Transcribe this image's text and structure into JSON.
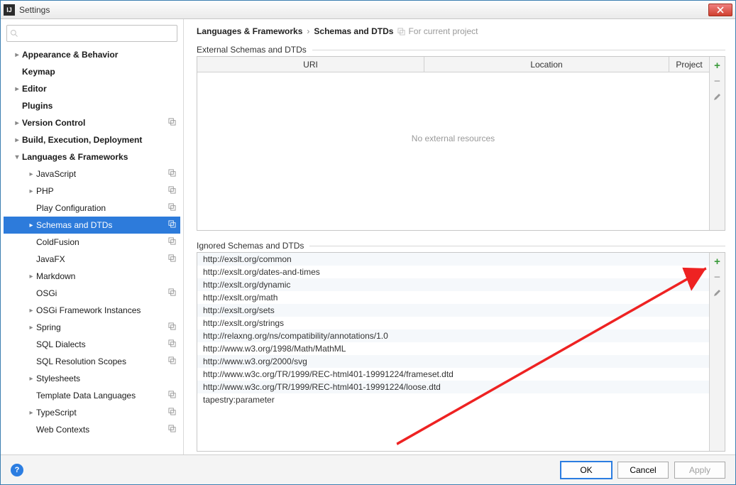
{
  "window": {
    "title": "Settings"
  },
  "search": {
    "placeholder": ""
  },
  "tree": [
    {
      "label": "Appearance & Behavior",
      "level": 0,
      "bold": true,
      "arrow": "right",
      "cp": false
    },
    {
      "label": "Keymap",
      "level": 0,
      "bold": true,
      "arrow": "",
      "cp": false
    },
    {
      "label": "Editor",
      "level": 0,
      "bold": true,
      "arrow": "right",
      "cp": false
    },
    {
      "label": "Plugins",
      "level": 0,
      "bold": true,
      "arrow": "",
      "cp": false
    },
    {
      "label": "Version Control",
      "level": 0,
      "bold": true,
      "arrow": "right",
      "cp": true
    },
    {
      "label": "Build, Execution, Deployment",
      "level": 0,
      "bold": true,
      "arrow": "right",
      "cp": false
    },
    {
      "label": "Languages & Frameworks",
      "level": 0,
      "bold": true,
      "arrow": "down",
      "cp": false
    },
    {
      "label": "JavaScript",
      "level": 1,
      "bold": false,
      "arrow": "right",
      "cp": true
    },
    {
      "label": "PHP",
      "level": 1,
      "bold": false,
      "arrow": "right",
      "cp": true
    },
    {
      "label": "Play Configuration",
      "level": 1,
      "bold": false,
      "arrow": "",
      "cp": true
    },
    {
      "label": "Schemas and DTDs",
      "level": 1,
      "bold": false,
      "arrow": "right",
      "cp": true,
      "selected": true
    },
    {
      "label": "ColdFusion",
      "level": 1,
      "bold": false,
      "arrow": "",
      "cp": true
    },
    {
      "label": "JavaFX",
      "level": 1,
      "bold": false,
      "arrow": "",
      "cp": true
    },
    {
      "label": "Markdown",
      "level": 1,
      "bold": false,
      "arrow": "right",
      "cp": false
    },
    {
      "label": "OSGi",
      "level": 1,
      "bold": false,
      "arrow": "",
      "cp": true
    },
    {
      "label": "OSGi Framework Instances",
      "level": 1,
      "bold": false,
      "arrow": "right",
      "cp": false
    },
    {
      "label": "Spring",
      "level": 1,
      "bold": false,
      "arrow": "right",
      "cp": true
    },
    {
      "label": "SQL Dialects",
      "level": 1,
      "bold": false,
      "arrow": "",
      "cp": true
    },
    {
      "label": "SQL Resolution Scopes",
      "level": 1,
      "bold": false,
      "arrow": "",
      "cp": true
    },
    {
      "label": "Stylesheets",
      "level": 1,
      "bold": false,
      "arrow": "right",
      "cp": false
    },
    {
      "label": "Template Data Languages",
      "level": 1,
      "bold": false,
      "arrow": "",
      "cp": true
    },
    {
      "label": "TypeScript",
      "level": 1,
      "bold": false,
      "arrow": "right",
      "cp": true
    },
    {
      "label": "Web Contexts",
      "level": 1,
      "bold": false,
      "arrow": "",
      "cp": true
    }
  ],
  "breadcrumbs": {
    "parent": "Languages & Frameworks",
    "current": "Schemas and DTDs",
    "scope": "For current project"
  },
  "external": {
    "title": "External Schemas and DTDs",
    "columns": {
      "uri": "URI",
      "location": "Location",
      "project": "Project"
    },
    "empty": "No external resources"
  },
  "ignored": {
    "title": "Ignored Schemas and DTDs",
    "items": [
      "http://exslt.org/common",
      "http://exslt.org/dates-and-times",
      "http://exslt.org/dynamic",
      "http://exslt.org/math",
      "http://exslt.org/sets",
      "http://exslt.org/strings",
      "http://relaxng.org/ns/compatibility/annotations/1.0",
      "http://www.w3.org/1998/Math/MathML",
      "http://www.w3.org/2000/svg",
      "http://www.w3c.org/TR/1999/REC-html401-19991224/frameset.dtd",
      "http://www.w3c.org/TR/1999/REC-html401-19991224/loose.dtd",
      "tapestry:parameter"
    ]
  },
  "footer": {
    "ok": "OK",
    "cancel": "Cancel",
    "apply": "Apply"
  }
}
